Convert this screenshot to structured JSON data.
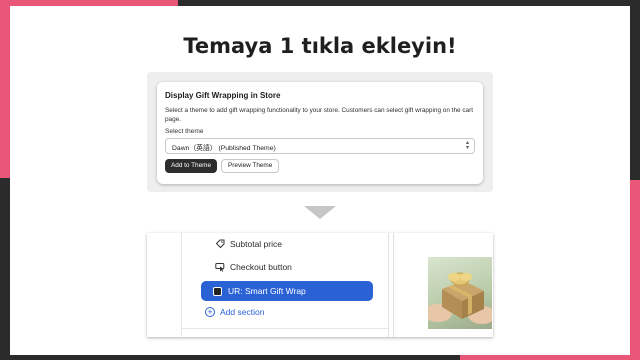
{
  "headline": "Temaya 1 tıkla ekleyin!",
  "panel": {
    "title": "Display Gift Wrapping in Store",
    "description": "Select a theme to add gift wrapping functionality to your store. Customers can select gift wrapping on the cart page.",
    "select_label": "Select theme",
    "selected_theme": "Dawn（英語） (Published Theme)",
    "add_button": "Add to Theme",
    "preview_button": "Preview Theme"
  },
  "editor": {
    "items": {
      "subtotal": "Subtotal price",
      "checkout": "Checkout button",
      "gift_wrap": "UR: Smart Gift Wrap",
      "add_section": "Add section"
    }
  },
  "colors": {
    "accent_pink": "#e85777",
    "dark": "#2b2b2b",
    "selected_blue": "#2a62d6"
  }
}
